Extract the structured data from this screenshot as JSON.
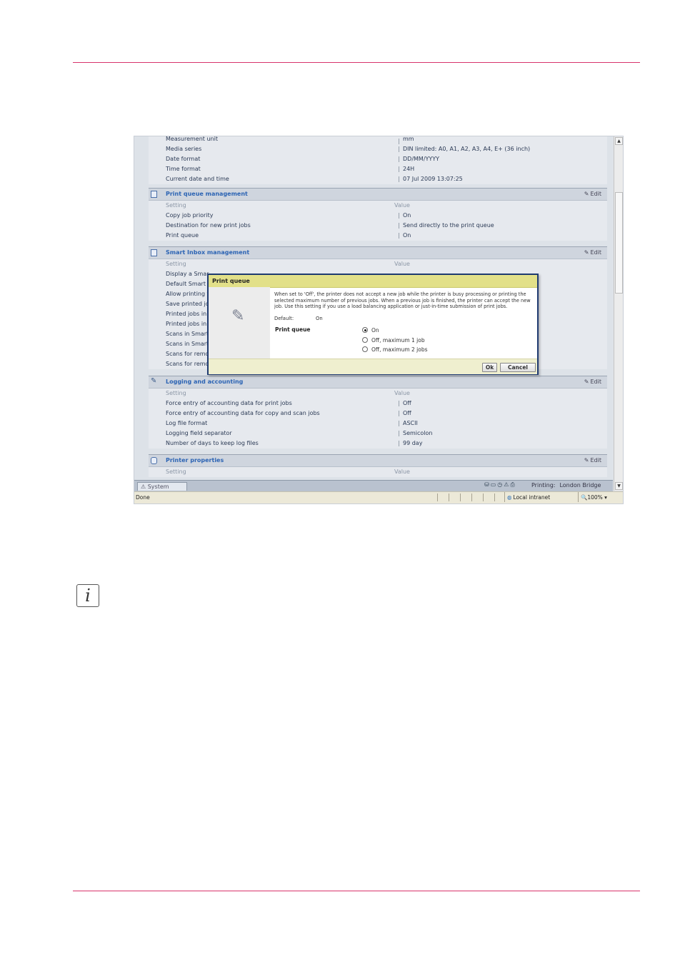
{
  "general_rows": [
    {
      "label": "Measurement unit",
      "value": "mm"
    },
    {
      "label": "Media series",
      "value": "DIN limited: A0, A1, A2, A3, A4, E+ (36 inch)"
    },
    {
      "label": "Date format",
      "value": "DD/MM/YYYY"
    },
    {
      "label": "Time format",
      "value": "24H"
    },
    {
      "label": "Current date and time",
      "value": "07 Jul 2009 13:07:25"
    }
  ],
  "edit_label": "Edit",
  "col_setting": "Setting",
  "col_value": "Value",
  "print_queue_section": {
    "title": "Print queue management",
    "rows": [
      {
        "label": "Copy job priority",
        "value": "On"
      },
      {
        "label": "Destination for new print jobs",
        "value": "Send directly to the print queue"
      },
      {
        "label": "Print queue",
        "value": "On"
      }
    ]
  },
  "smart_inbox_section": {
    "title": "Smart Inbox management",
    "rows": [
      {
        "label": "Display a Smar"
      },
      {
        "label": "Default Smart I"
      },
      {
        "label": "Allow printing f"
      },
      {
        "label": "Save printed jo"
      },
      {
        "label": "Printed jobs in"
      },
      {
        "label": "Printed jobs in"
      },
      {
        "label": "Scans in Smart"
      },
      {
        "label": "Scans in Smart"
      },
      {
        "label": "Scans for remo"
      },
      {
        "label": "Scans for remo"
      }
    ]
  },
  "logging_section": {
    "title": "Logging and accounting",
    "rows": [
      {
        "label": "Force entry of accounting data for print jobs",
        "value": "Off"
      },
      {
        "label": "Force entry of accounting data for copy and scan jobs",
        "value": "Off"
      },
      {
        "label": "Log file format",
        "value": "ASCII"
      },
      {
        "label": "Logging field separator",
        "value": "Semicolon"
      },
      {
        "label": "Number of days to keep log files",
        "value": "99 day"
      }
    ]
  },
  "printer_props_section": {
    "title": "Printer properties"
  },
  "tabbar": {
    "tab_label": "System",
    "printing_label": "Printing:",
    "printing_value": "London Bridge"
  },
  "statusbar": {
    "done": "Done",
    "zone": "Local intranet",
    "zoom": "100%"
  },
  "dialog": {
    "title": "Print queue",
    "description": "When set to 'Off', the printer does not accept a new job while the printer is busy processing or printing the selected maximum number of previous jobs. When a previous job is finished, the printer can accept the new job. Use this setting if you use a load balancing application or just-in-time submission of print jobs.",
    "default_label": "Default:",
    "default_value": "On",
    "setting_label": "Print queue",
    "options": [
      {
        "label": "On",
        "selected": true
      },
      {
        "label": "Off, maximum 1 job",
        "selected": false
      },
      {
        "label": "Off, maximum 2 jobs",
        "selected": false
      }
    ],
    "ok_label": "Ok",
    "cancel_label": "Cancel"
  },
  "colors": {
    "accent_rule": "#d8336b",
    "section_title": "#2c64b4",
    "dialog_title_bg": "#e2e089",
    "dialog_border": "#1f3a70"
  }
}
